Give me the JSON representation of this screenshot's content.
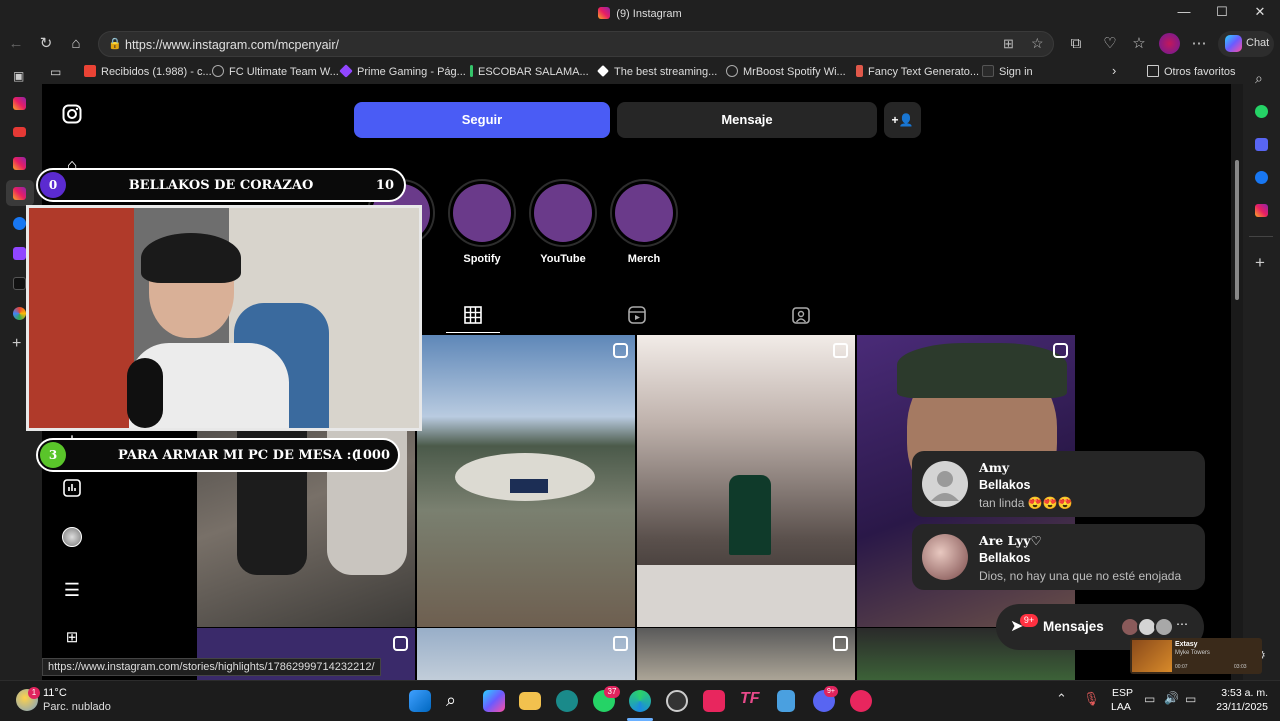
{
  "window": {
    "title": "(9) Instagram",
    "minimize": "—",
    "maximize": "☐",
    "close": "✕"
  },
  "address_bar": {
    "url": "https://www.instagram.com/mcpenyair/",
    "chat_label": "Chat"
  },
  "bookmarks": [
    {
      "label": "Recibidos (1.988) - c...",
      "color": "#ea4335"
    },
    {
      "label": "FC Ultimate Team W...",
      "color": "#888888"
    },
    {
      "label": "Prime Gaming - Pág...",
      "color": "#9146ff"
    },
    {
      "label": "ESCOBAR SALAMA...",
      "color": "#35c46a"
    },
    {
      "label": "The best streaming...",
      "color": "#ffffff"
    },
    {
      "label": "MrBoost Spotify Wi...",
      "color": "#888888"
    },
    {
      "label": "Fancy Text Generato...",
      "color": "#e0584a"
    },
    {
      "label": "Sign in",
      "color": "#2a2a2a"
    }
  ],
  "bookmarks_other": "Otros favoritos",
  "profile": {
    "follow_button": "Seguir",
    "message_button": "Mensaje",
    "add_friend_icon": "+👤"
  },
  "highlights": [
    {
      "label": "Spotify"
    },
    {
      "label": "YouTube"
    },
    {
      "label": "Merch"
    }
  ],
  "stream_overlay": {
    "goal_top": {
      "current": "0",
      "title": "BELLAKOS DE CORAZAO",
      "target": "10"
    },
    "goal_bottom": {
      "current": "3",
      "title": "PARA ARMAR MI PC DE MESA :(",
      "target": "1000"
    }
  },
  "notifications": [
    {
      "name": "Amy",
      "group": "Bellakos",
      "message": "tan linda 😍😍😍"
    },
    {
      "name": "Are Lyy♡",
      "group": "Bellakos",
      "message": "Dios, no hay una que no esté enojada"
    }
  ],
  "messages_pill": {
    "label": "Mensajes",
    "badge": "9+"
  },
  "music_widget": {
    "title": "Extasy",
    "artist": "Myke Towers",
    "elapsed": "00:07",
    "duration": "03:03"
  },
  "status_url": "https://www.instagram.com/stories/highlights/17862999714232212/",
  "taskbar": {
    "weather_temp": "11°C",
    "weather_desc": "Parc. nublado",
    "weather_badge": "1",
    "whatsapp_badge": "37",
    "discord_badge": "9+",
    "lang": "ESP",
    "layout": "LAA",
    "time": "3:53 a. m.",
    "date": "23/11/2025"
  }
}
